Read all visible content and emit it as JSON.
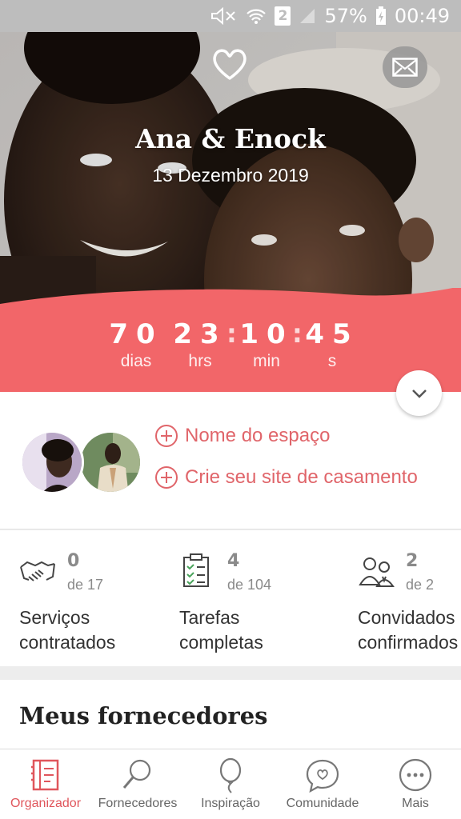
{
  "status_bar": {
    "battery": "57%",
    "time": "00:49",
    "sim_badge": "2"
  },
  "hero": {
    "couple_names": "Ana & Enock",
    "wedding_date": "13 Dezembro 2019",
    "logo_icon": "heart-icon",
    "mail_icon": "mail-icon"
  },
  "countdown": {
    "days": "70",
    "days_label": "dias",
    "hours": "23",
    "hours_label": "hrs",
    "minutes": "10",
    "minutes_label": "min",
    "seconds": "45",
    "seconds_label": "s",
    "separator": ":"
  },
  "couple_card": {
    "venue_link": "Nome do espaço",
    "website_link": "Crie seu site de casamento"
  },
  "stats": [
    {
      "icon": "handshake-icon",
      "count": "0",
      "of": "de 17",
      "label_line1": "Serviços",
      "label_line2": "contratados"
    },
    {
      "icon": "checklist-icon",
      "count": "4",
      "of": "de 104",
      "label_line1": "Tarefas",
      "label_line2": "completas"
    },
    {
      "icon": "guests-icon",
      "count": "2",
      "of": "de 2",
      "label_line1": "Convidados",
      "label_line2": "confirmados"
    }
  ],
  "suppliers": {
    "title": "Meus fornecedores"
  },
  "bottom_nav": [
    {
      "label": "Organizador",
      "icon": "notebook-icon",
      "active": true
    },
    {
      "label": "Fornecedores",
      "icon": "magnifier-icon",
      "active": false
    },
    {
      "label": "Inspiração",
      "icon": "balloon-icon",
      "active": false
    },
    {
      "label": "Comunidade",
      "icon": "chat-heart-icon",
      "active": false
    },
    {
      "label": "Mais",
      "icon": "more-icon",
      "active": false
    }
  ],
  "colors": {
    "accent": "#f26669",
    "accent_text": "#e0656a",
    "status_bar": "#bdbdbd"
  }
}
